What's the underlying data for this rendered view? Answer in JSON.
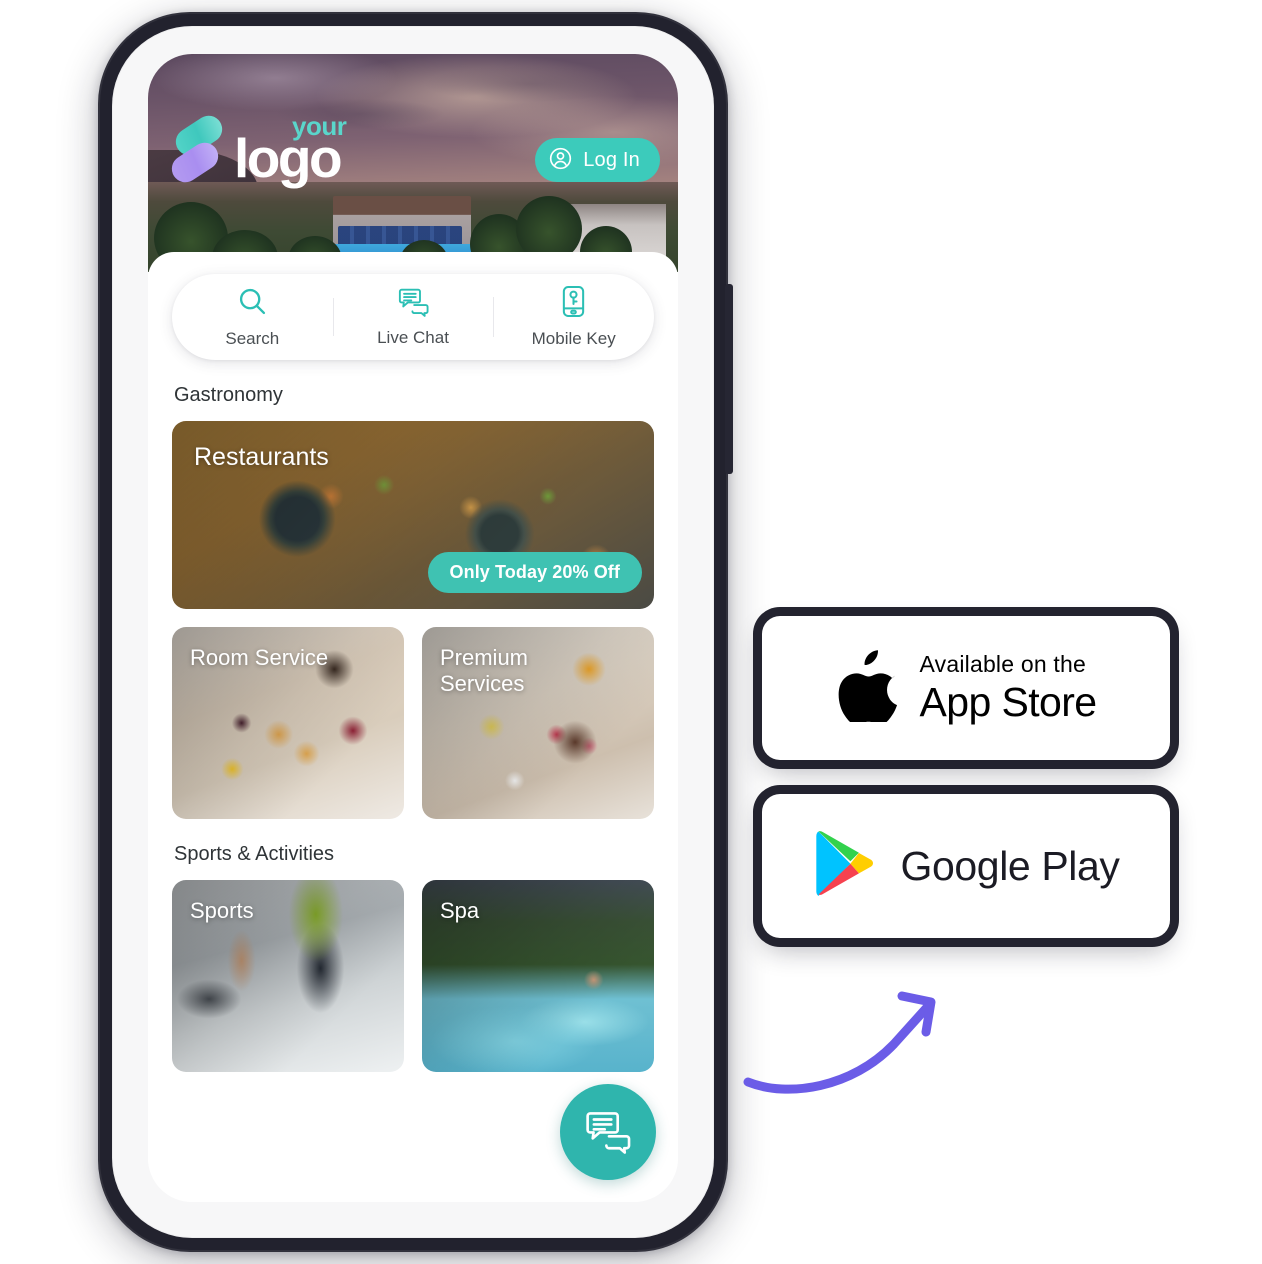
{
  "colors": {
    "teal": "#3ccbbb",
    "teal_dark": "#2fb5ad",
    "badge_teal": "#3fc2b2",
    "logo_teal": "#5ad6cb",
    "logo_purple": "#b49bf0",
    "arrow_purple": "#6b5ce7",
    "text_dark": "#2f3437",
    "frame_dark": "#23232f"
  },
  "phone": {
    "hero": {
      "brand": {
        "line1": "your",
        "line2": "logo"
      },
      "login_button": {
        "label": "Log In",
        "icon": "user-circle-icon"
      }
    },
    "quick_actions": [
      {
        "label": "Search",
        "icon": "search-icon"
      },
      {
        "label": "Live Chat",
        "icon": "chat-bubbles-icon"
      },
      {
        "label": "Mobile Key",
        "icon": "mobile-key-icon"
      }
    ],
    "sections": [
      {
        "title": "Gastronomy",
        "feature_card": {
          "title": "Restaurants",
          "badge": "Only Today 20% Off"
        },
        "cards": [
          {
            "title": "Room Service"
          },
          {
            "title": "Premium Services"
          }
        ]
      },
      {
        "title": "Sports & Activities",
        "cards": [
          {
            "title": "Sports"
          },
          {
            "title": "Spa"
          }
        ]
      }
    ],
    "chat_fab": {
      "icon": "chat-bubbles-icon"
    }
  },
  "stores": [
    {
      "icon": "apple-logo-icon",
      "line1": "Available on the",
      "line2": "App Store"
    },
    {
      "icon": "google-play-icon",
      "line1": "",
      "line2": "Google Play"
    }
  ],
  "decoration": {
    "arrow": "curved-arrow-icon"
  }
}
